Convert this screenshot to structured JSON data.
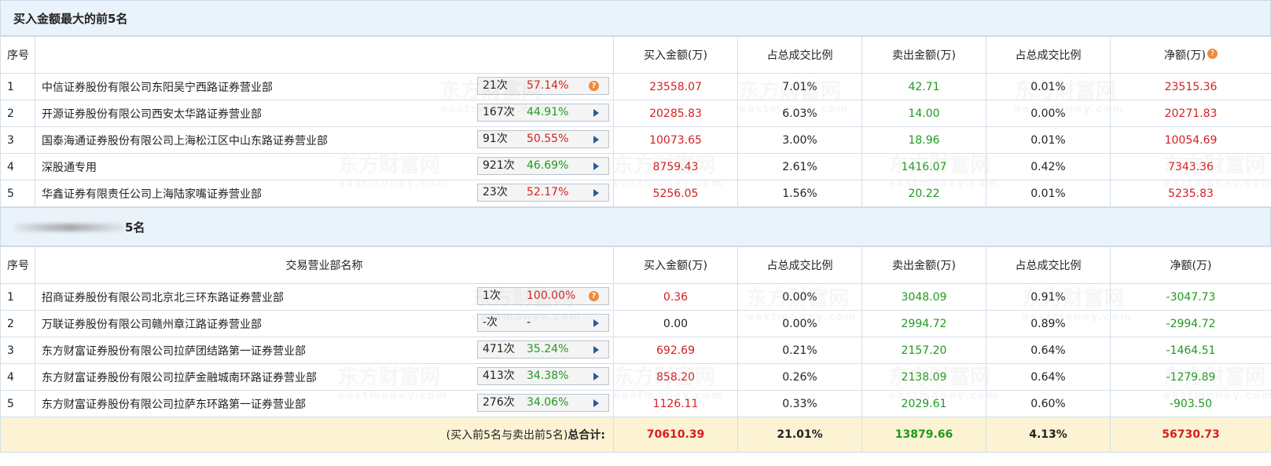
{
  "buy_section": {
    "title": "买入金额最大的前5名",
    "headers": [
      "序号",
      "",
      "买入金额(万)",
      "占总成交比例",
      "卖出金额(万)",
      "占总成交比例",
      "净额(万)"
    ],
    "rows": [
      {
        "seq": "1",
        "name": "中信证券股份有限公司东阳吴宁西路证券营业部",
        "count": "21次",
        "pct": "57.14%",
        "pct_color": "red",
        "icon": "question",
        "buy": "23558.07",
        "buy_ratio": "7.01%",
        "sell": "42.71",
        "sell_ratio": "0.01%",
        "net": "23515.36",
        "net_color": "red"
      },
      {
        "seq": "2",
        "name": "开源证券股份有限公司西安太华路证券营业部",
        "count": "167次",
        "pct": "44.91%",
        "pct_color": "green",
        "icon": "arrow",
        "buy": "20285.83",
        "buy_ratio": "6.03%",
        "sell": "14.00",
        "sell_ratio": "0.00%",
        "net": "20271.83",
        "net_color": "red"
      },
      {
        "seq": "3",
        "name": "国泰海通证券股份有限公司上海松江区中山东路证券营业部",
        "count": "91次",
        "pct": "50.55%",
        "pct_color": "red",
        "icon": "arrow",
        "buy": "10073.65",
        "buy_ratio": "3.00%",
        "sell": "18.96",
        "sell_ratio": "0.01%",
        "net": "10054.69",
        "net_color": "red"
      },
      {
        "seq": "4",
        "name": "深股通专用",
        "count": "921次",
        "pct": "46.69%",
        "pct_color": "green",
        "icon": "arrow",
        "buy": "8759.43",
        "buy_ratio": "2.61%",
        "sell": "1416.07",
        "sell_ratio": "0.42%",
        "net": "7343.36",
        "net_color": "red"
      },
      {
        "seq": "5",
        "name": "华鑫证券有限责任公司上海陆家嘴证券营业部",
        "count": "23次",
        "pct": "52.17%",
        "pct_color": "red",
        "icon": "arrow",
        "buy": "5256.05",
        "buy_ratio": "1.56%",
        "sell": "20.22",
        "sell_ratio": "0.01%",
        "net": "5235.83",
        "net_color": "red"
      }
    ]
  },
  "sell_section": {
    "title": "5名",
    "headers": [
      "序号",
      "交易营业部名称",
      "买入金额(万)",
      "占总成交比例",
      "卖出金额(万)",
      "占总成交比例",
      "净额(万)"
    ],
    "rows": [
      {
        "seq": "1",
        "name": "招商证券股份有限公司北京北三环东路证券营业部",
        "count": "1次",
        "pct": "100.00%",
        "pct_color": "red",
        "icon": "question",
        "buy": "0.36",
        "buy_ratio": "0.00%",
        "sell": "3048.09",
        "sell_ratio": "0.91%",
        "net": "-3047.73",
        "net_color": "green",
        "buy_color": "red"
      },
      {
        "seq": "2",
        "name": "万联证券股份有限公司赣州章江路证券营业部",
        "count": "-次",
        "pct": "-",
        "pct_color": "black",
        "icon": "arrow",
        "buy": "0.00",
        "buy_ratio": "0.00%",
        "sell": "2994.72",
        "sell_ratio": "0.89%",
        "net": "-2994.72",
        "net_color": "green",
        "buy_color": "black"
      },
      {
        "seq": "3",
        "name": "东方财富证券股份有限公司拉萨团结路第一证券营业部",
        "count": "471次",
        "pct": "35.24%",
        "pct_color": "green",
        "icon": "arrow",
        "buy": "692.69",
        "buy_ratio": "0.21%",
        "sell": "2157.20",
        "sell_ratio": "0.64%",
        "net": "-1464.51",
        "net_color": "green",
        "buy_color": "red"
      },
      {
        "seq": "4",
        "name": "东方财富证券股份有限公司拉萨金融城南环路证券营业部",
        "count": "413次",
        "pct": "34.38%",
        "pct_color": "green",
        "icon": "arrow",
        "buy": "858.20",
        "buy_ratio": "0.26%",
        "sell": "2138.09",
        "sell_ratio": "0.64%",
        "net": "-1279.89",
        "net_color": "green",
        "buy_color": "red"
      },
      {
        "seq": "5",
        "name": "东方财富证券股份有限公司拉萨东环路第一证券营业部",
        "count": "276次",
        "pct": "34.06%",
        "pct_color": "green",
        "icon": "arrow",
        "buy": "1126.11",
        "buy_ratio": "0.33%",
        "sell": "2029.61",
        "sell_ratio": "0.60%",
        "net": "-903.50",
        "net_color": "green",
        "buy_color": "red"
      }
    ]
  },
  "total": {
    "label_prefix": "(买入前5名与卖出前5名)",
    "label_bold": "总合计:",
    "buy": "70610.39",
    "buy_ratio": "21.01%",
    "sell": "13879.66",
    "sell_ratio": "4.13%",
    "net": "56730.73"
  },
  "watermark": {
    "cn": "东方财富网",
    "en": "eastmoney.com"
  },
  "colors": {
    "red": "#d42020",
    "green": "#1e9a1e",
    "header_bg": "#eaf2fa",
    "total_bg": "#fbf3d3",
    "accent_orange": "#f08a3c",
    "arrow_blue": "#2c5aa0"
  }
}
